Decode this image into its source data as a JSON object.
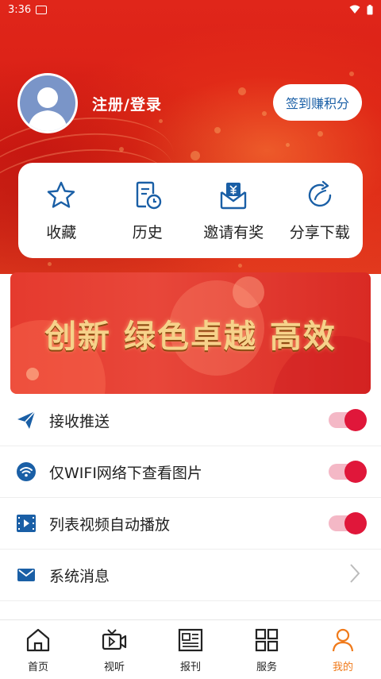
{
  "status_bar": {
    "time": "3:36"
  },
  "profile": {
    "login_text": "注册/登录",
    "checkin_label": "签到赚积分"
  },
  "quick_actions": [
    {
      "label": "收藏",
      "icon": "star-icon"
    },
    {
      "label": "历史",
      "icon": "history-icon"
    },
    {
      "label": "邀请有奖",
      "icon": "invite-icon"
    },
    {
      "label": "分享下载",
      "icon": "share-icon"
    }
  ],
  "banner": {
    "text": "创新 绿色卓越 高效"
  },
  "settings": [
    {
      "label": "接收推送",
      "icon": "send-icon",
      "control": "toggle",
      "on": true
    },
    {
      "label": "仅WIFI网络下查看图片",
      "icon": "wifi-icon",
      "control": "toggle",
      "on": true
    },
    {
      "label": "列表视频自动播放",
      "icon": "video-icon",
      "control": "toggle",
      "on": true
    },
    {
      "label": "系统消息",
      "icon": "mail-icon",
      "control": "chevron"
    }
  ],
  "tabs": [
    {
      "label": "首页",
      "icon": "home-icon",
      "active": false
    },
    {
      "label": "视听",
      "icon": "video-camera-icon",
      "active": false
    },
    {
      "label": "报刊",
      "icon": "newspaper-icon",
      "active": false
    },
    {
      "label": "服务",
      "icon": "grid-icon",
      "active": false
    },
    {
      "label": "我的",
      "icon": "user-icon",
      "active": true
    }
  ],
  "colors": {
    "header_red": "#d81e14",
    "toggle_on": "#e0173a",
    "icon_blue": "#1a5fa6",
    "tab_active": "#f07a1a"
  }
}
